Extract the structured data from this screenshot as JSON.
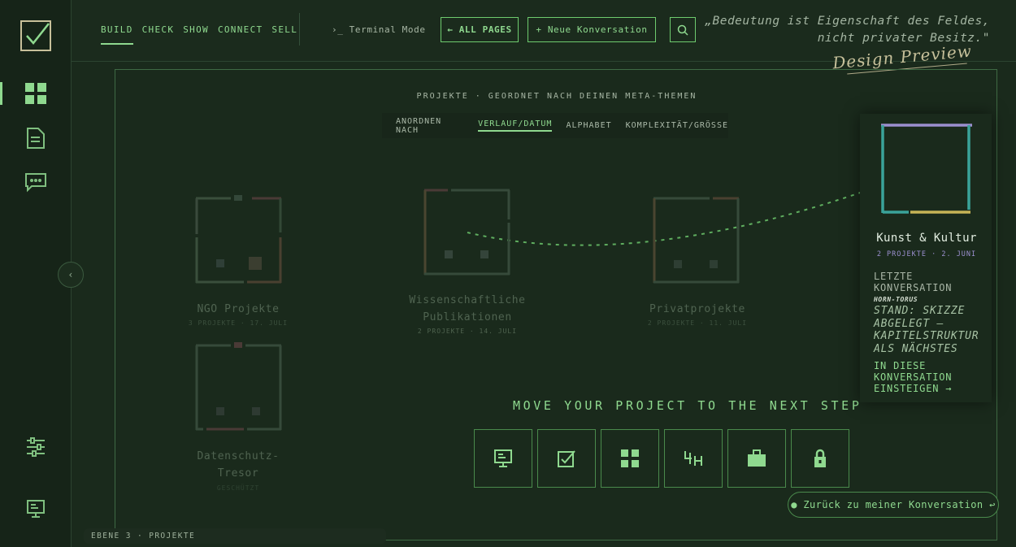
{
  "nav": {
    "items": [
      "BUILD",
      "CHECK",
      "SHOW",
      "CONNECT",
      "SELL"
    ],
    "active": "BUILD"
  },
  "header": {
    "terminal_label": "›_ Terminal Mode",
    "all_pages_label": "← ALL PAGES",
    "new_conversation_label": "+ Neue Konversation",
    "quote_line1": "„Bedeutung ist Eigenschaft des Feldes,",
    "quote_line2": "nicht privater Besitz.\"",
    "design_preview": "Design Preview"
  },
  "canvas": {
    "heading": "PROJEKTE · GEORDNET NACH DEINEN META-THEMEN",
    "sort": {
      "label": "ANORDNEN NACH",
      "options": [
        "VERLAUF/DATUM",
        "ALPHABET",
        "KOMPLEXITÄT/GRÖSSE"
      ],
      "active": "VERLAUF/DATUM"
    }
  },
  "projects": [
    {
      "title": "NGO Projekte",
      "meta": "3 PROJEKTE · 17. JULI"
    },
    {
      "title_line1": "Wissenschaftliche",
      "title_line2": "Publikationen",
      "meta": "2 PROJEKTE · 14. JULI"
    },
    {
      "title": "Privatprojekte",
      "meta": "2 PROJEKTE · 11. JULI"
    },
    {
      "title_line1": "Datenschutz-",
      "title_line2": "Tresor",
      "meta": "GESCHÜTZT"
    }
  ],
  "featured": {
    "title": "Kunst & Kultur",
    "meta": "2 PROJEKTE · 2. JUNI",
    "last_label_line1": "LETZTE",
    "last_label_line2": "KONVERSATION",
    "conv_name": "HORN-TORUS",
    "stand_line1": "STAND: SKIZZE",
    "stand_line2": "ABGELEGT —",
    "stand_line3": "KAPITELSTRUKTUR",
    "stand_line4": "ALS NÄCHSTES",
    "cta_line1": "IN DIESE",
    "cta_line2": "KONVERSATION",
    "cta_line3": "EINSTEIGEN →"
  },
  "next_step": {
    "heading": "MOVE YOUR PROJECT TO THE NEXT STEP"
  },
  "back_button": "● Zurück zu meiner Konversation ↩",
  "footer": "EBENE 3 · PROJEKTE",
  "colors": {
    "accent": "#8fd98f",
    "background": "#1a2a1c",
    "purple": "#9b8fcf",
    "teal": "#3aa39a",
    "gold": "#c6b356"
  }
}
